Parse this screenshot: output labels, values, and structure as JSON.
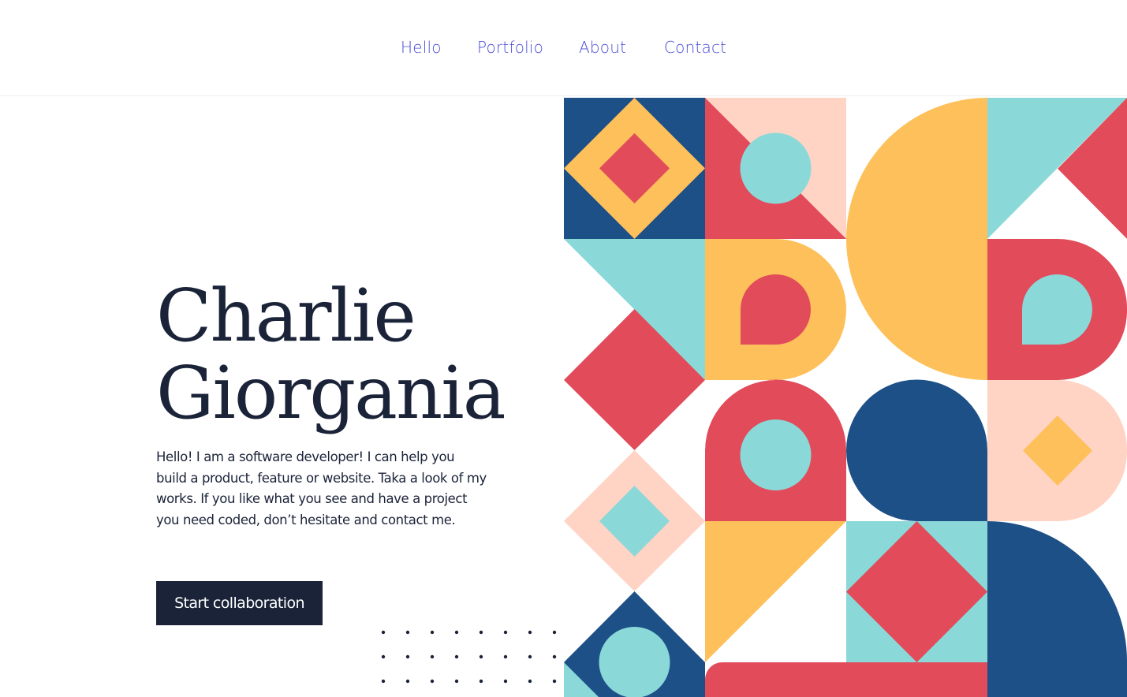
{
  "nav": {
    "items": [
      {
        "label": "Hello"
      },
      {
        "label": "Portfolio"
      },
      {
        "label": "About"
      },
      {
        "label": "Contact"
      }
    ]
  },
  "hero": {
    "name_line1": "Charlie",
    "name_line2": "Giorgania",
    "description": "Hello! I am a software developer! I can help you build a product, feature or website. Taka a look of my works. If you like what you see and have a project you need coded, don’t hesitate and contact me.",
    "cta_label": "Start collaboration"
  },
  "colors": {
    "navy": "#1d5087",
    "yellow": "#fdc05a",
    "red": "#e14b5a",
    "teal": "#8ad8d8",
    "peach": "#ffd4c4",
    "ink": "#1b2339",
    "nav_link": "#4a4cd6"
  }
}
